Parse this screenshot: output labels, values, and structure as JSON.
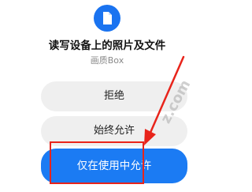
{
  "dialog": {
    "title": "读写设备上的照片及文件",
    "app_name": "画质Box"
  },
  "buttons": {
    "deny": "拒绝",
    "always_allow": "始终允许",
    "allow_while_using": "仅在使用中允许"
  },
  "watermark": "z.com",
  "colors": {
    "accent": "#1B7BF3",
    "icon_bg": "#1A73F0",
    "annotation": "#E8241B",
    "button_bg": "#EFEFEF"
  },
  "icons": {
    "app": "document-icon",
    "annotation": "arrow-annotation"
  }
}
